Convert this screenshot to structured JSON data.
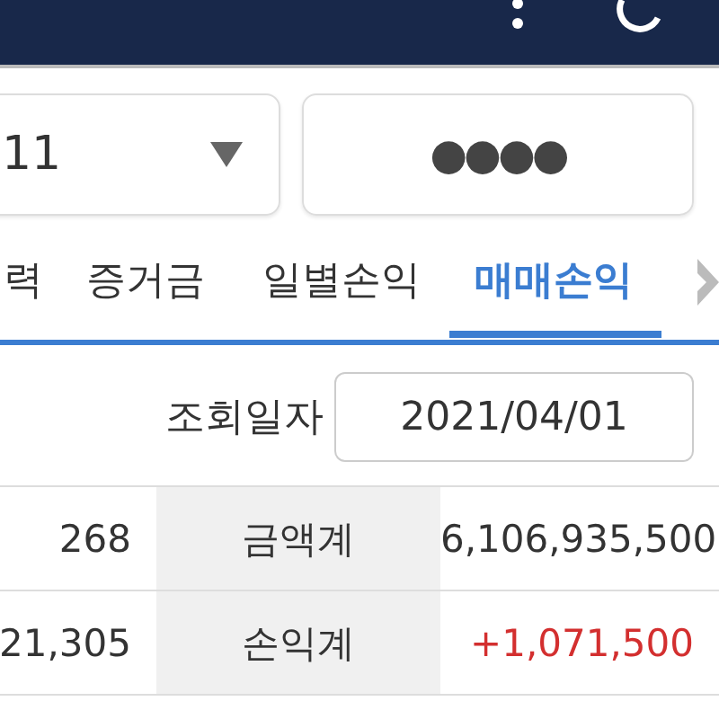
{
  "account": {
    "select": {
      "value": "11"
    },
    "password": {
      "value": "●●●●"
    }
  },
  "tabs": [
    {
      "label": "력",
      "selected": false
    },
    {
      "label": "증거금",
      "selected": false
    },
    {
      "label": "일별손익",
      "selected": false
    },
    {
      "label": "매매손익",
      "selected": true
    }
  ],
  "query": {
    "label": "조회일자",
    "date": "2021/04/01"
  },
  "summary": [
    {
      "value": "268",
      "label": "금액계",
      "amount": "6,106,935,500",
      "kind": "plain"
    },
    {
      "value": "21,305",
      "label": "손익계",
      "amount": "+1,071,500",
      "kind": "gain"
    }
  ]
}
